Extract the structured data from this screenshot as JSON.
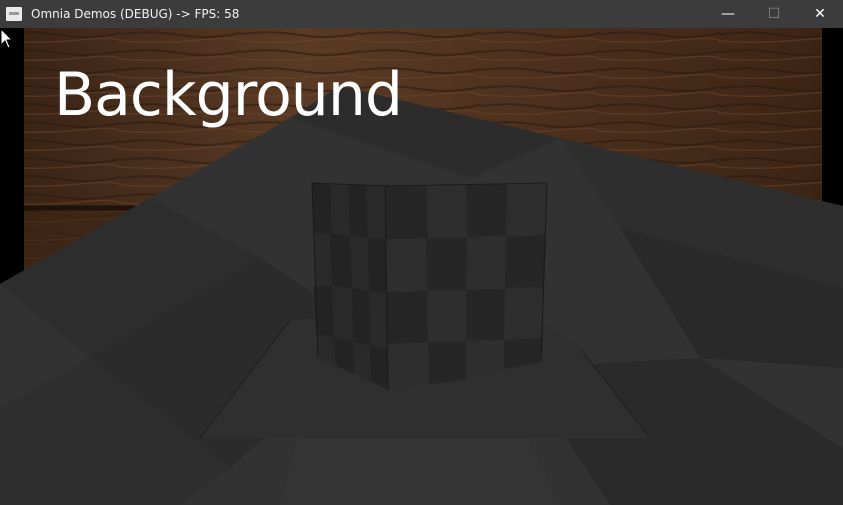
{
  "window": {
    "title": "Omnia Demos (DEBUG) -> FPS: 58",
    "buttons": {
      "minimize": "—",
      "maximize": "☐",
      "close": "✕"
    }
  },
  "scene": {
    "background_label": "Background",
    "colors": {
      "wood_dark": "#2a1a10",
      "wood_mid": "#4a2e1c",
      "floor": "#333333",
      "floor_dark": "#2a2a2a",
      "cube_light": "#353535",
      "cube_dark": "#262626"
    }
  }
}
